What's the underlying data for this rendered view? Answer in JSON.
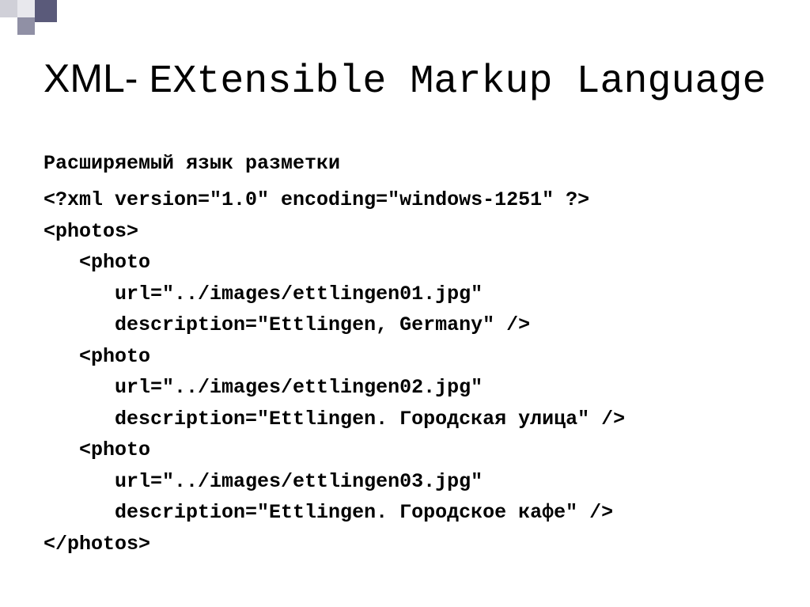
{
  "title": {
    "prefix": "XML- ",
    "rest": "EXtensible Markup Language"
  },
  "subtitle": "Расширяемый язык разметки",
  "code": {
    "lines": [
      "<?xml version=\"1.0\" encoding=\"windows-1251\" ?>",
      "<photos>",
      "   <photo",
      "      url=\"../images/ettlingen01.jpg\"",
      "      description=\"Ettlingen, Germany\" />",
      "   <photo",
      "      url=\"../images/ettlingen02.jpg\"",
      "      description=\"Ettlingen. Городская улица\" />",
      "   <photo",
      "      url=\"../images/ettlingen03.jpg\"",
      "      description=\"Ettlingen. Городское кафе\" />",
      "</photos>"
    ]
  }
}
